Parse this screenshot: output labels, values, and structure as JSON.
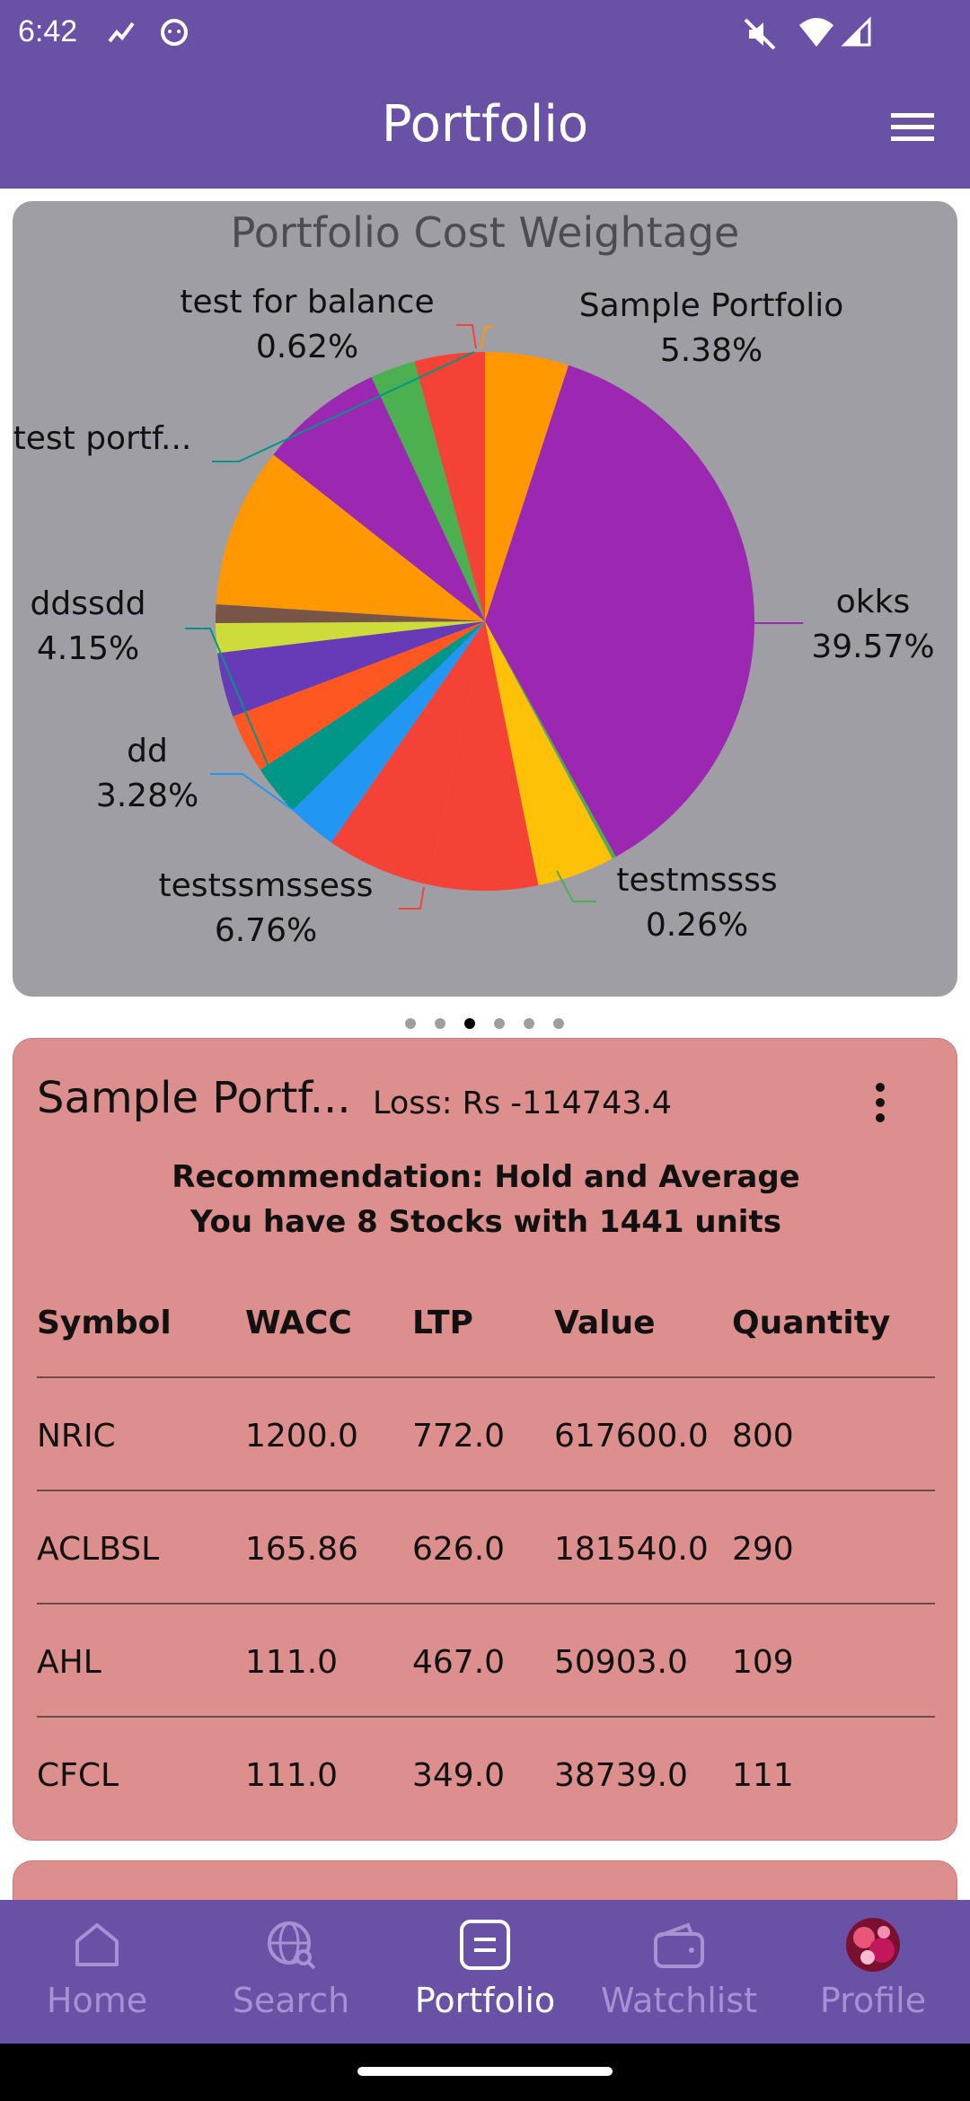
{
  "status_bar": {
    "time": "6:42",
    "icons": [
      "stock-trend-icon",
      "cat-face-icon",
      "mute-icon",
      "wifi-icon",
      "signal-icon"
    ]
  },
  "app_bar": {
    "title": "Portfolio",
    "menu_icon": "hamburger-menu-icon"
  },
  "chart_data": {
    "type": "pie",
    "title": "Portfolio Cost Weightage",
    "slices": [
      {
        "label": "Sample Portfolio",
        "value": 5.38,
        "color": "#ff9800",
        "labeled": true
      },
      {
        "label": "okks",
        "value": 39.57,
        "color": "#9c27b0",
        "labeled": true
      },
      {
        "label": "testmssss",
        "value": 0.26,
        "color": "#4caf50",
        "labeled": true
      },
      {
        "label": "",
        "value": 5.0,
        "color": "#ffc107",
        "labeled": false
      },
      {
        "label": "",
        "value": 7.0,
        "color": "#f44336",
        "labeled": false
      },
      {
        "label": "testssmssess",
        "value": 6.76,
        "color": "#f44336",
        "labeled": true
      },
      {
        "label": "",
        "value": 3.2,
        "color": "#2196f3",
        "labeled": false
      },
      {
        "label": "dd",
        "value": 3.28,
        "color": "#009688",
        "labeled": true
      },
      {
        "label": "",
        "value": 3.8,
        "color": "#ff5722",
        "labeled": false
      },
      {
        "label": "ddssdd",
        "value": 4.15,
        "color": "#673ab7",
        "labeled": true
      },
      {
        "label": "",
        "value": 1.9,
        "color": "#cddc39",
        "labeled": false
      },
      {
        "label": "",
        "value": 1.2,
        "color": "#795548",
        "labeled": false
      },
      {
        "label": "",
        "value": 10.3,
        "color": "#ff9800",
        "labeled": false
      },
      {
        "label": "test portf...",
        "value": 8.0,
        "color": "#9c27b0",
        "labeled": true
      },
      {
        "label": "",
        "value": 2.9,
        "color": "#4caf50",
        "labeled": false
      },
      {
        "label": "test for balance",
        "value": 0.62,
        "color": "#f44336",
        "labeled": true
      },
      {
        "label": "",
        "value": 3.9,
        "color": "#f44336",
        "labeled": false
      }
    ],
    "label_texts": {
      "sample_portfolio": {
        "name": "Sample Portfolio",
        "pct": "5.38%"
      },
      "okks": {
        "name": "okks",
        "pct": "39.57%"
      },
      "testmssss": {
        "name": "testmssss",
        "pct": "0.26%"
      },
      "testssmssess": {
        "name": "testssmssess",
        "pct": "6.76%"
      },
      "dd": {
        "name": "dd",
        "pct": "3.28%"
      },
      "ddssdd": {
        "name": "ddssdd",
        "pct": "4.15%"
      },
      "test_portf": {
        "name": "test portf...",
        "pct": ""
      },
      "test_for_balance": {
        "name": "test for balance",
        "pct": "0.62%"
      }
    },
    "page_indicator": {
      "count": 6,
      "active": 2
    }
  },
  "portfolio_card": {
    "name": "Sample Portf...",
    "loss": "Loss: Rs -114743.4",
    "recommendation": "Recommendation:  Hold and Average",
    "summary": "You have 8 Stocks with 1441 units",
    "columns": [
      "Symbol",
      "WACC",
      "LTP",
      "Value",
      "Quantity"
    ],
    "rows": [
      [
        "NRIC",
        "1200.0",
        "772.0",
        "617600.0",
        "800"
      ],
      [
        "ACLBSL",
        "165.86",
        "626.0",
        "181540.0",
        "290"
      ],
      [
        "AHL",
        "111.0",
        "467.0",
        "50903.0",
        "109"
      ],
      [
        "CFCL",
        "111.0",
        "349.0",
        "38739.0",
        "111"
      ]
    ]
  },
  "bottom_nav": {
    "items": [
      {
        "label": "Home",
        "icon": "home-icon"
      },
      {
        "label": "Search",
        "icon": "globe-search-icon"
      },
      {
        "label": "Portfolio",
        "icon": "portfolio-icon"
      },
      {
        "label": "Watchlist",
        "icon": "wallet-icon"
      },
      {
        "label": "Profile",
        "icon": "avatar"
      }
    ],
    "active": "Portfolio"
  }
}
